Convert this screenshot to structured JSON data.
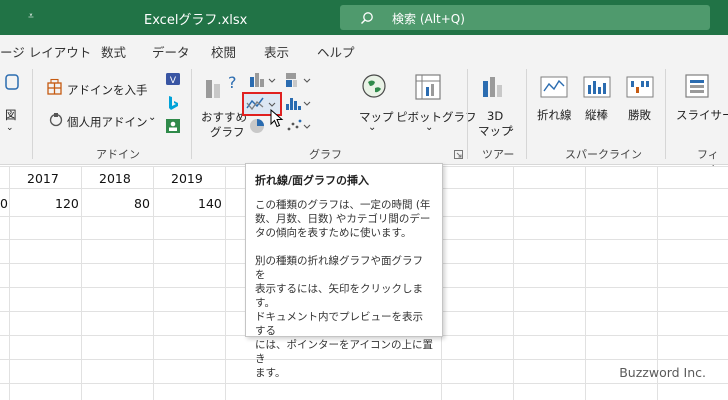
{
  "titlebar": {
    "title": "Excelグラフ.xlsx",
    "search_placeholder": "検索 (Alt+Q)",
    "qat_dropdown": "⩡"
  },
  "tabs": [
    "ージ レイアウト",
    "数式",
    "データ",
    "校閲",
    "表示",
    "ヘルプ"
  ],
  "ribbon": {
    "addins": {
      "get_addins": "アドインを入手",
      "my_addins": "個人用アドイン",
      "group_label": "アドイン"
    },
    "charts": {
      "recommended_line1": "おすすめ",
      "recommended_line2": "グラフ",
      "maps": "マップ",
      "pivot_chart": "ピボットグラフ",
      "group_label": "グラフ"
    },
    "tours": {
      "map3d_line1": "3D",
      "map3d_line2": "マップ",
      "group_label": "ツアー"
    },
    "sparklines": {
      "line": "折れ線",
      "column": "縦棒",
      "win_loss": "勝敗",
      "group_label": "スパークライン"
    },
    "filters": {
      "slicer": "スライサー",
      "group_label": "フィルタ"
    },
    "left_cut_label": "図"
  },
  "sheet": {
    "headers": [
      "2017",
      "2018",
      "2019"
    ],
    "values": [
      "0",
      "120",
      "80",
      "140"
    ]
  },
  "tooltip": {
    "title": "折れ線/面グラフの挿入",
    "para1": "この種類のグラフは、一定の時間 (年\n数、月数、日数) やカテゴリ間のデー\nタの傾向を表すために使います。",
    "para2": "別の種類の折れ線グラフや面グラフを\n表示するには、矢印をクリックします。\nドキュメント内でプレビューを表示する\nには、ポインターをアイコンの上に置き\nます。"
  },
  "watermark": "Buzzword Inc.",
  "colors": {
    "title_bar": "#217346",
    "ribbon_bg": "#f3f3f3",
    "highlight": "#e02020"
  }
}
